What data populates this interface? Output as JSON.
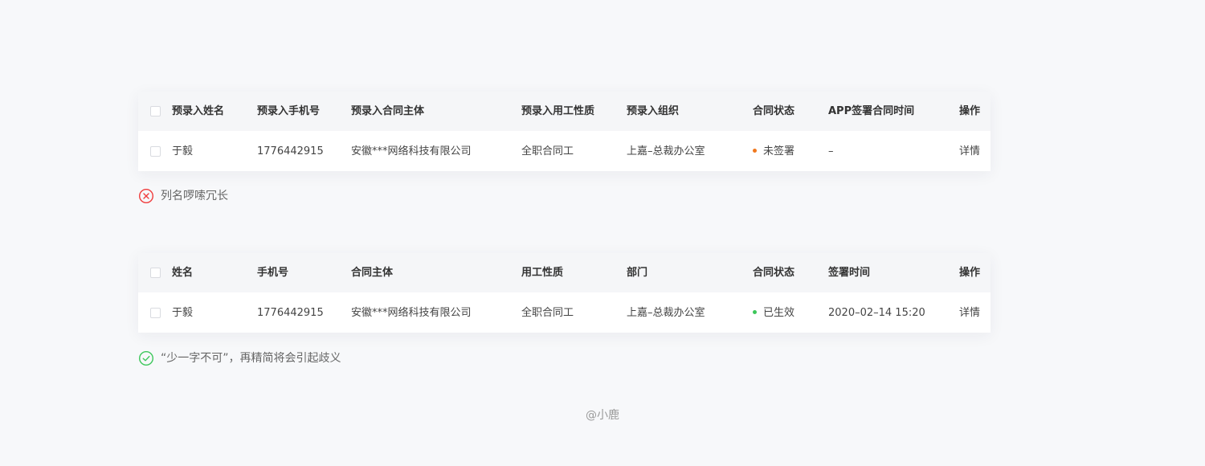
{
  "colors": {
    "link": "#3370ff",
    "status_pending": "#f0781e",
    "status_active": "#3cc75a",
    "error": "#f03c3c",
    "success": "#3cc75a"
  },
  "bad_example": {
    "headers": [
      "预录入姓名",
      "预录入手机号",
      "预录入合同主体",
      "预录入用工性质",
      "预录入组织",
      "合同状态",
      "APP签署合同时间",
      "操作"
    ],
    "row": {
      "name": "于毅",
      "phone": "1776442915",
      "entity": "安徽***网络科技有限公司",
      "employment_type": "全职合同工",
      "org": "上嘉–总裁办公室",
      "status": "未签署",
      "sign_time": "–",
      "action": "详情"
    },
    "note": "列名啰嗦冗长",
    "note_icon": "error-circle-icon"
  },
  "good_example": {
    "headers": [
      "姓名",
      "手机号",
      "合同主体",
      "用工性质",
      "部门",
      "合同状态",
      "签署时间",
      "操作"
    ],
    "row": {
      "name": "于毅",
      "phone": "1776442915",
      "entity": "安徽***网络科技有限公司",
      "employment_type": "全职合同工",
      "org": "上嘉–总裁办公室",
      "status": "已生效",
      "sign_time": "2020–02–14 15:20",
      "action": "详情"
    },
    "note": "“少一字不可”，再精简将会引起歧义",
    "note_icon": "success-circle-icon"
  },
  "credit": "@小鹿"
}
